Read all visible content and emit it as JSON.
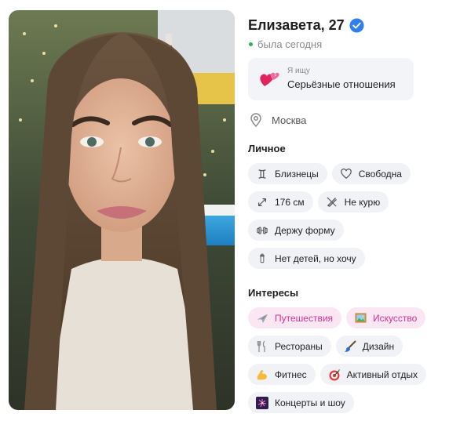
{
  "profile": {
    "name_age": "Елизавета, 27",
    "verified_icon": "verified-check-icon",
    "status": "была сегодня",
    "status_color": "#27b45b",
    "seeking": {
      "label": "Я ищу",
      "value": "Серьёзные отношения",
      "icon": "hearts-icon"
    },
    "city": {
      "icon": "location-pin-icon",
      "value": "Москва"
    }
  },
  "personal": {
    "title": "Личное",
    "chips": [
      {
        "icon": "gemini-icon",
        "label": "Близнецы"
      },
      {
        "icon": "heart-outline-icon",
        "label": "Свободна"
      },
      {
        "icon": "height-arrows-icon",
        "label": "176 см"
      },
      {
        "icon": "no-smoking-icon",
        "label": "Не курю"
      },
      {
        "icon": "dumbbell-icon",
        "label": "Держу форму"
      },
      {
        "icon": "baby-bottle-icon",
        "label": "Нет детей, но хочу"
      }
    ]
  },
  "interests": {
    "title": "Интересы",
    "highlight_color": "#d6338f",
    "chips": [
      {
        "icon": "airplane-icon",
        "label": "Путешествия",
        "highlighted": true
      },
      {
        "icon": "framed-picture-icon",
        "label": "Искусство",
        "highlighted": true
      },
      {
        "icon": "fork-knife-icon",
        "label": "Рестораны",
        "highlighted": false
      },
      {
        "icon": "paintbrush-icon",
        "label": "Дизайн",
        "highlighted": false
      },
      {
        "icon": "flexed-bicep-icon",
        "label": "Фитнес",
        "highlighted": false
      },
      {
        "icon": "dart-target-icon",
        "label": "Активный отдых",
        "highlighted": false
      },
      {
        "icon": "fireworks-icon",
        "label": "Концерты и шоу",
        "highlighted": false
      }
    ]
  }
}
